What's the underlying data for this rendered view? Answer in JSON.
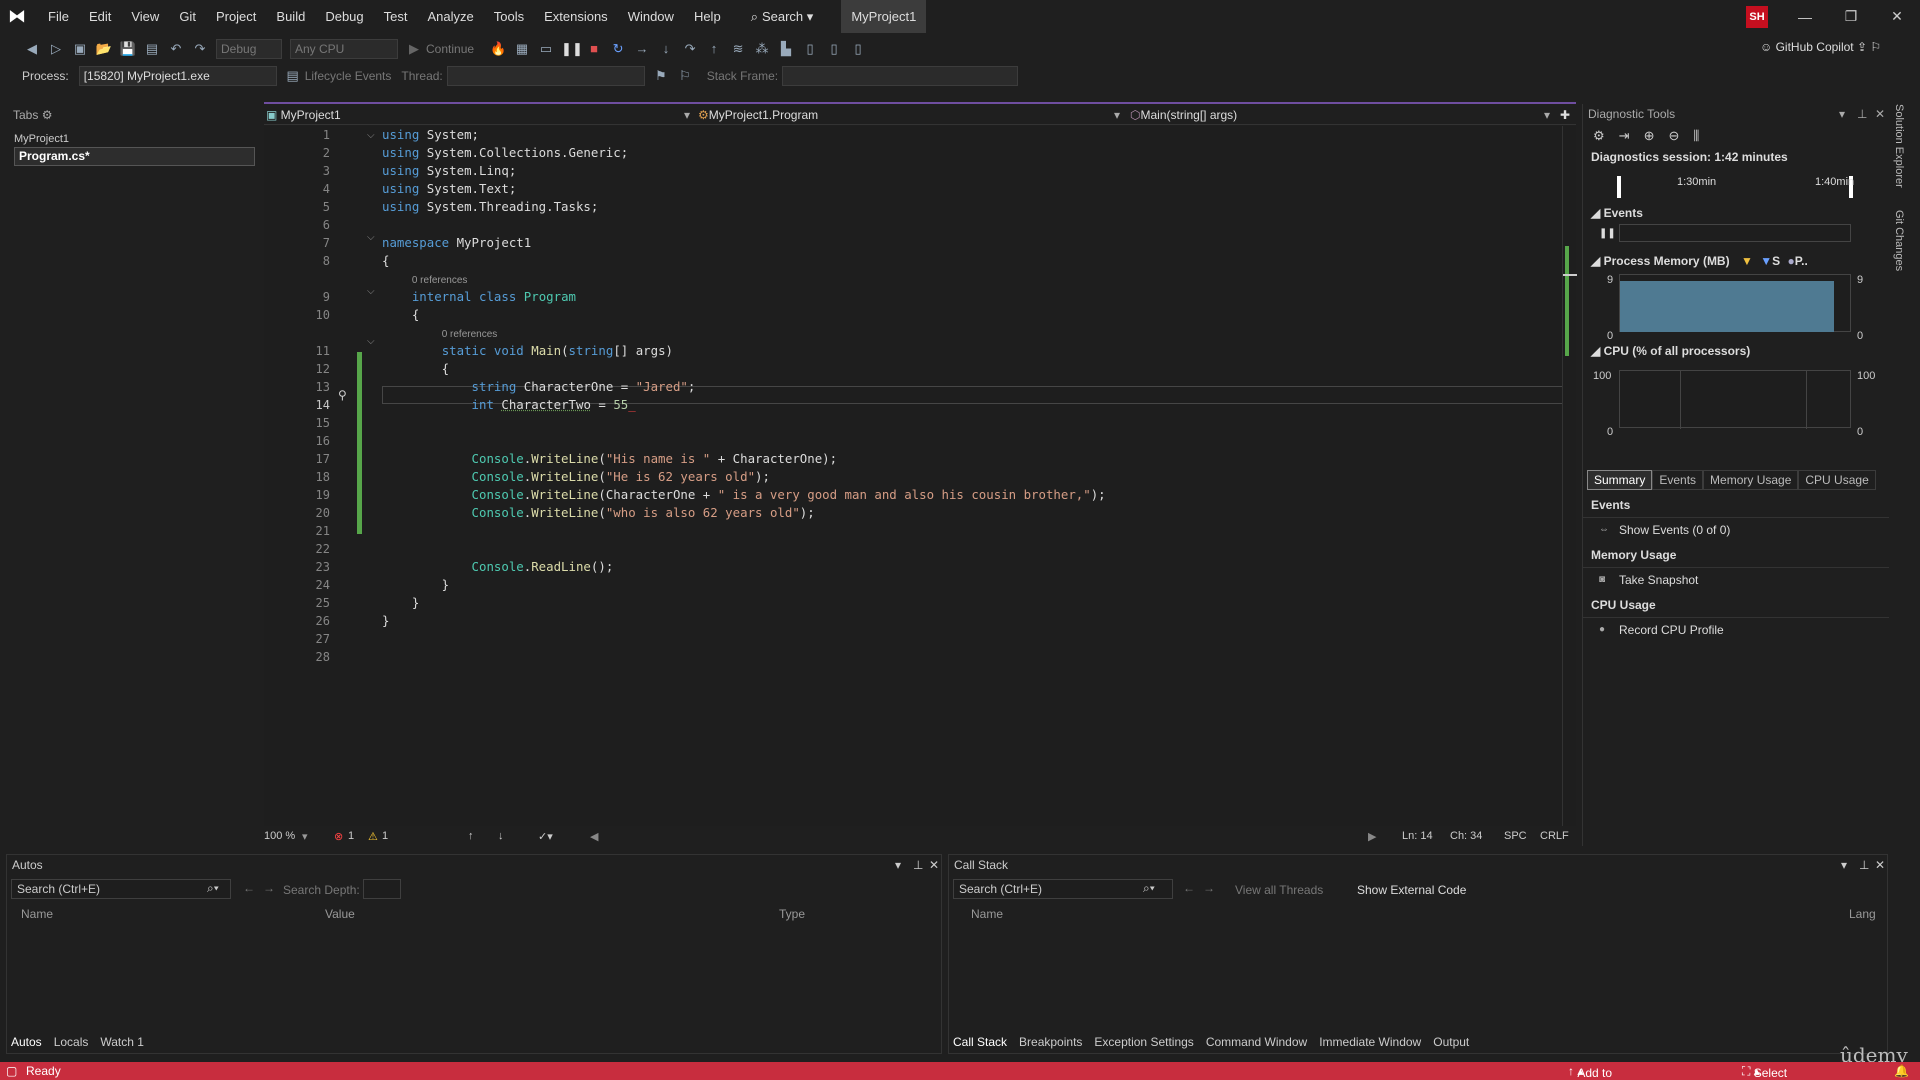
{
  "menubar": {
    "items": [
      "File",
      "Edit",
      "View",
      "Git",
      "Project",
      "Build",
      "Debug",
      "Test",
      "Analyze",
      "Tools",
      "Extensions",
      "Window",
      "Help"
    ],
    "search": "Search",
    "project": "MyProject1",
    "avatar": "SH"
  },
  "toolbar": {
    "config": "Debug",
    "platform": "Any CPU",
    "continue": "Continue",
    "copilot": "GitHub Copilot",
    "process_label": "Process:",
    "process_value": "[15820] MyProject1.exe",
    "lifecycle": "Lifecycle Events",
    "thread": "Thread:",
    "stack_frame": "Stack Frame:"
  },
  "tabs_panel": {
    "title": "Tabs",
    "group": "MyProject1",
    "file": "Program.cs*"
  },
  "editor_nav": {
    "project": "MyProject1",
    "class": "MyProject1.Program",
    "member": "Main(string[] args)"
  },
  "editor": {
    "line_numbers": [
      "1",
      "2",
      "3",
      "4",
      "5",
      "6",
      "7",
      "8",
      "9",
      "10",
      "11",
      "12",
      "13",
      "14",
      "15",
      "16",
      "17",
      "18",
      "19",
      "20",
      "21",
      "22",
      "23",
      "24",
      "25",
      "26",
      "27",
      "28"
    ],
    "references": "0 references"
  },
  "editor_status": {
    "zoom": "100 %",
    "errors": "1",
    "warnings": "1",
    "ln": "Ln: 14",
    "ch": "Ch: 34",
    "spc": "SPC",
    "crlf": "CRLF"
  },
  "diagnostics": {
    "title": "Diagnostic Tools",
    "session": "Diagnostics session: 1:42 minutes",
    "tick1": "1:30min",
    "tick2": "1:40min",
    "events": "Events",
    "memory": "Process Memory (MB)",
    "mem_max": "9",
    "mem_min": "0",
    "legend_s": "S",
    "legend_p": "P..",
    "cpu": "CPU (% of all processors)",
    "cpu_max": "100",
    "cpu_min": "0",
    "tabs": [
      "Summary",
      "Events",
      "Memory Usage",
      "CPU Usage"
    ],
    "sec_events": "Events",
    "show_events": "Show Events (0 of 0)",
    "sec_memory": "Memory Usage",
    "take_snapshot": "Take Snapshot",
    "sec_cpu": "CPU Usage",
    "record_cpu": "Record CPU Profile"
  },
  "autos": {
    "title": "Autos",
    "search": "Search (Ctrl+E)",
    "depth": "Search Depth:",
    "cols": [
      "Name",
      "Value",
      "Type"
    ],
    "tabs": [
      "Autos",
      "Locals",
      "Watch 1"
    ]
  },
  "callstack": {
    "title": "Call Stack",
    "search": "Search (Ctrl+E)",
    "view_threads": "View all Threads",
    "show_external": "Show External Code",
    "cols": [
      "Name",
      "Lang"
    ],
    "tabs": [
      "Call Stack",
      "Breakpoints",
      "Exception Settings",
      "Command Window",
      "Immediate Window",
      "Output"
    ]
  },
  "statusbar": {
    "ready": "Ready",
    "source_control": "Add to Source Control",
    "repo": "Select Repository"
  },
  "side_tabs": [
    "Solution Explorer",
    "Git Changes"
  ],
  "watermark": "ûdemy"
}
